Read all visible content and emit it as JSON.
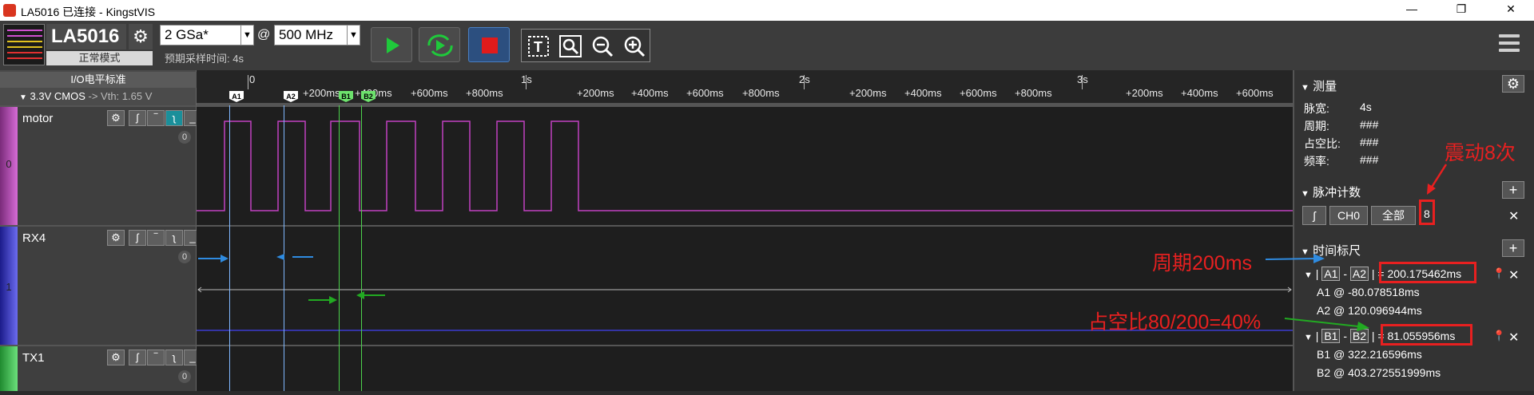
{
  "window": {
    "title": "LA5016 已连接 - KingstVIS",
    "minimize": "—",
    "maximize": "❐",
    "close": "✕"
  },
  "toolbar": {
    "device_name": "LA5016",
    "device_mode": "正常模式",
    "sample_rate": "2 GSa*",
    "at": "@",
    "frequency": "500 MHz",
    "estimated_time": "预期采样时间: 4s",
    "start_icon": "play-icon",
    "loop_icon": "loop-play-icon",
    "stop_icon": "stop-icon",
    "tools": [
      "text-tool-icon",
      "search-tool-icon",
      "zoom-out-icon",
      "zoom-in-icon"
    ],
    "colors": {
      "start": "#1fc93b",
      "stop": "#e01b1b"
    }
  },
  "io": {
    "title": "I/O电平标准",
    "level": "3.3V CMOS",
    "vth": "-> Vth: 1.65 V"
  },
  "ruler": {
    "major": [
      "0",
      "1s",
      "2s",
      "3s"
    ],
    "minor": [
      "+200ms",
      "+400ms",
      "+600ms",
      "+800ms",
      "+200ms",
      "+400ms",
      "+600ms",
      "+800ms",
      "+200ms",
      "+400ms",
      "+600ms",
      "+800ms",
      "+200ms",
      "+400ms",
      "+600ms"
    ],
    "cursors": [
      "A1",
      "A2",
      "B1",
      "B2"
    ]
  },
  "channels": [
    {
      "name": "motor",
      "index": "0",
      "count": "0",
      "color": "#c040c0"
    },
    {
      "name": "RX4",
      "index": "1",
      "count": "0",
      "color": "#3b3bd0"
    },
    {
      "name": "TX1",
      "index": "2",
      "count": "0",
      "color": "#49d25a"
    }
  ],
  "channel_buttons": [
    "⚙",
    "ʃ",
    "‾",
    "ʅ",
    "_"
  ],
  "measure": {
    "title": "测量",
    "rows": [
      {
        "label": "脉宽:",
        "value": "4s"
      },
      {
        "label": "周期:",
        "value": "###"
      },
      {
        "label": "占空比:",
        "value": "###"
      },
      {
        "label": "频率:",
        "value": "###"
      }
    ]
  },
  "pulse_count": {
    "title": "脉冲计数",
    "edge": "ʃ",
    "channel": "CH0",
    "range": "全部",
    "colon": ":",
    "value": "8"
  },
  "time_ruler": {
    "title": "时间标尺",
    "pairs": [
      {
        "a": "A1",
        "b": "A2",
        "value": "200.175462ms",
        "p1": "A1 @ -80.078518ms",
        "p2": "A2 @ 120.096944ms"
      },
      {
        "a": "B1",
        "b": "B2",
        "value": "81.055956ms",
        "p1": "B1 @ 322.216596ms",
        "p2": "B2 @ 403.272551999ms"
      }
    ]
  },
  "annotations": {
    "shake": "震动8次",
    "period": "周期200ms",
    "duty": "占空比80/200=40%"
  }
}
